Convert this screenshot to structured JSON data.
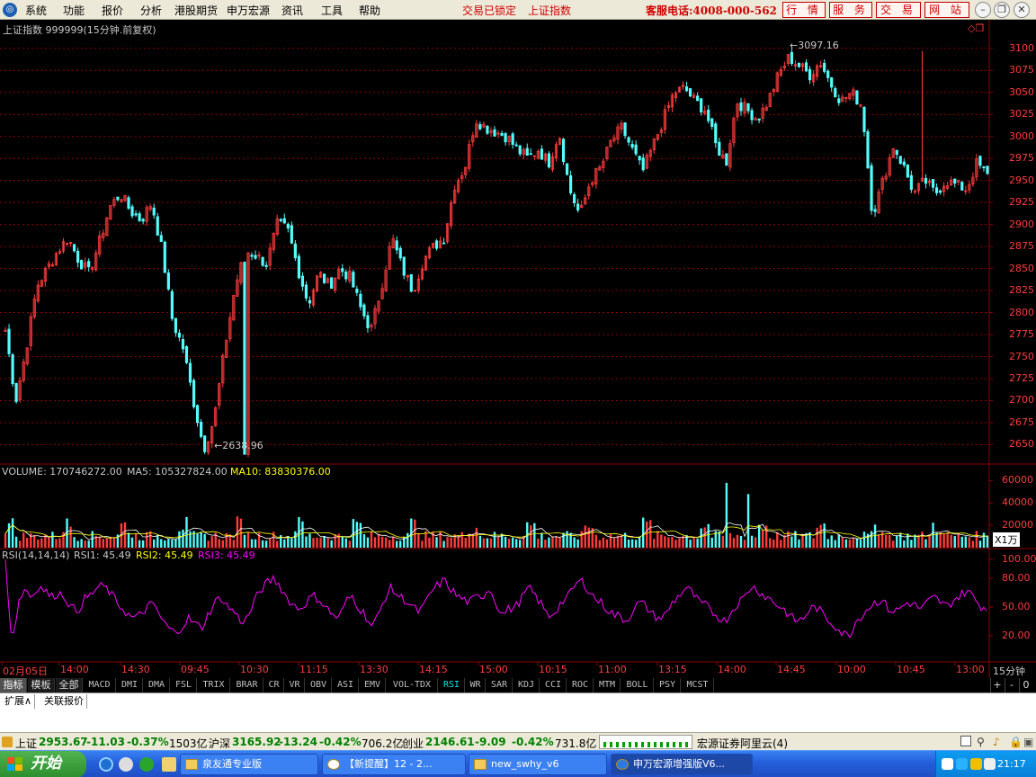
{
  "menubar": {
    "items": [
      "系统",
      "功能",
      "报价",
      "分析",
      "港股期货",
      "申万宏源",
      "资讯",
      "工具",
      "帮助"
    ],
    "lock_status": "交易已锁定",
    "index_name": "上证指数",
    "hotline": "客服电话:4008-000-562",
    "buttons": [
      "行 情",
      "服 务",
      "交 易",
      "网 站"
    ]
  },
  "chart": {
    "header": "上证指数 999999(15分钟.前复权)",
    "price_ticks": [
      "3100",
      "3075",
      "3050",
      "3025",
      "3000",
      "2975",
      "2950",
      "2925",
      "2900",
      "2875",
      "2850",
      "2825",
      "2800",
      "2775",
      "2750",
      "2725",
      "2700",
      "2675",
      "2650"
    ],
    "high_label": "3097.16",
    "low_label": "2638.96",
    "volume_header": {
      "volume": "VOLUME: 170746272.00",
      "ma5": "MA5: 105327824.00",
      "ma10": "MA10: 83830376.00"
    },
    "volume_ticks": [
      "60000",
      "40000",
      "20000"
    ],
    "volume_unit": "X1万",
    "rsi_header": {
      "name": "RSI(14,14,14)",
      "rsi1": "RSI1: 45.49",
      "rsi2": "RSI2: 45.49",
      "rsi3": "RSI3: 45.49"
    },
    "rsi_ticks": [
      "100.00",
      "80.00",
      "50.00",
      "20.00"
    ],
    "time_labels": [
      "02月05日",
      "14:00",
      "14:30",
      "09:45",
      "10:30",
      "11:15",
      "13:30",
      "14:15",
      "15:00",
      "10:15",
      "11:00",
      "13:15",
      "14:00",
      "14:45",
      "10:00",
      "10:45",
      "13:00"
    ],
    "period": "15分钟",
    "colors": {
      "up": "#ff3c3c",
      "down": "#54fcfc",
      "grid": "#8b0000",
      "ma5": "#ffffff",
      "ma10": "#ffff00",
      "rsi": "#ff00ff"
    }
  },
  "chart_data": {
    "type": "candlestick",
    "title": "上证指数 999999(15分钟.前复权)",
    "y_range": [
      2638.96,
      3097.16
    ],
    "ylim": [
      2630,
      3110
    ],
    "high": 3097.16,
    "low": 2638.96,
    "close_path": [
      2780,
      2700,
      2760,
      2830,
      2850,
      2870,
      2885,
      2860,
      2845,
      2880,
      2920,
      2935,
      2915,
      2905,
      2925,
      2870,
      2790,
      2760,
      2700,
      2645,
      2680,
      2760,
      2830,
      2870,
      2865,
      2855,
      2900,
      2895,
      2850,
      2810,
      2845,
      2830,
      2850,
      2840,
      2805,
      2780,
      2830,
      2885,
      2850,
      2825,
      2860,
      2875,
      2885,
      2945,
      2965,
      3020,
      3010,
      3005,
      3000,
      2985,
      2975,
      2985,
      2970,
      3005,
      2940,
      2910,
      2950,
      2965,
      2995,
      3010,
      2985,
      2960,
      2990,
      3020,
      3050,
      3055,
      3040,
      3030,
      2990,
      2970,
      3040,
      3030,
      3020,
      3040,
      3070,
      3090,
      3080,
      3070,
      3085,
      3060,
      3040,
      3050,
      3035,
      2910,
      2950,
      2990,
      2965,
      2935,
      2950,
      2935,
      2950,
      2945,
      2940,
      2970,
      2955
    ],
    "volume": {
      "current": 170746272.0,
      "ma5": 105327824.0,
      "ma10": 83830376.0,
      "unit": "X1万",
      "ticks": [
        20000,
        40000,
        60000
      ]
    },
    "rsi": {
      "params": [
        14,
        14,
        14
      ],
      "rsi1": 45.49,
      "rsi2": 45.49,
      "rsi3": 45.49,
      "ticks": [
        20,
        50,
        80,
        100
      ],
      "path": [
        100,
        12,
        55,
        70,
        60,
        72,
        68,
        60,
        65,
        62,
        50,
        45,
        58,
        62,
        70,
        72,
        65,
        55,
        48,
        40,
        38,
        45,
        52,
        50,
        35,
        28,
        22,
        30,
        38,
        32,
        28,
        42,
        55,
        60,
        50,
        45,
        35,
        38,
        55,
        68,
        75,
        80,
        72,
        60,
        52,
        48,
        55,
        62,
        58,
        50,
        42,
        38,
        55,
        62,
        50,
        42,
        30,
        40,
        60,
        70,
        62,
        58,
        52,
        45,
        50,
        65,
        72,
        78,
        70,
        62,
        58,
        55,
        60,
        62,
        70,
        55,
        42,
        48,
        50,
        60,
        70,
        62,
        52,
        40,
        45,
        55,
        60,
        72,
        78,
        70,
        60,
        55,
        48,
        42,
        40,
        35,
        48,
        55,
        50,
        42,
        38,
        42,
        55,
        62,
        70,
        65,
        55,
        52,
        45,
        40,
        35,
        45,
        55,
        60,
        72,
        68,
        62,
        58,
        52,
        48,
        40,
        35,
        38,
        48,
        50,
        42,
        35,
        30,
        22,
        20,
        35,
        42,
        50,
        55,
        58,
        48,
        45,
        50,
        55,
        52,
        48,
        55,
        60,
        55,
        50,
        58,
        62,
        68,
        60,
        52,
        48
      ]
    },
    "x_labels": [
      "02月05日",
      "14:00",
      "14:30",
      "09:45",
      "10:30",
      "11:15",
      "13:30",
      "14:15",
      "15:00",
      "10:15",
      "11:00",
      "13:15",
      "14:00",
      "14:45",
      "10:00",
      "10:45",
      "13:00"
    ]
  },
  "tabs": {
    "cn": [
      "指标",
      "模板",
      "全部"
    ],
    "indicators": [
      "MACD",
      "DMI",
      "DMA",
      "FSL",
      "TRIX",
      "BRAR",
      "CR",
      "VR",
      "OBV",
      "ASI",
      "EMV",
      "VOL-TDX",
      "RSI",
      "WR",
      "SAR",
      "KDJ",
      "CCI",
      "ROC",
      "MTM",
      "BOLL",
      "PSY",
      "MCST"
    ],
    "active": "RSI",
    "controls": [
      "+",
      "-",
      "0"
    ]
  },
  "extbar": [
    "扩展∧",
    "关联报价"
  ],
  "status": {
    "sh_name": "上证",
    "sh_price": "2953.67",
    "sh_chg": "-11.03",
    "sh_pct": "-0.37%",
    "sh_amt": "1503亿",
    "hs_name": "沪深",
    "hs_price": "3165.92",
    "hs_chg": "-13.24",
    "hs_pct": "-0.42%",
    "hs_amt": "706.2亿",
    "cy_name": "创业",
    "cy_price": "2146.61",
    "cy_chg": "-9.09",
    "cy_pct": "-0.42%",
    "cy_amt": "731.8亿",
    "server": "宏源证券阿里云(4)"
  },
  "taskbar": {
    "start": "开始",
    "tasks": [
      "泉友通专业版",
      "【新提醒】12 - 2...",
      "new_swhy_v6",
      "申万宏源增强版V6..."
    ],
    "clock": "21:17"
  }
}
